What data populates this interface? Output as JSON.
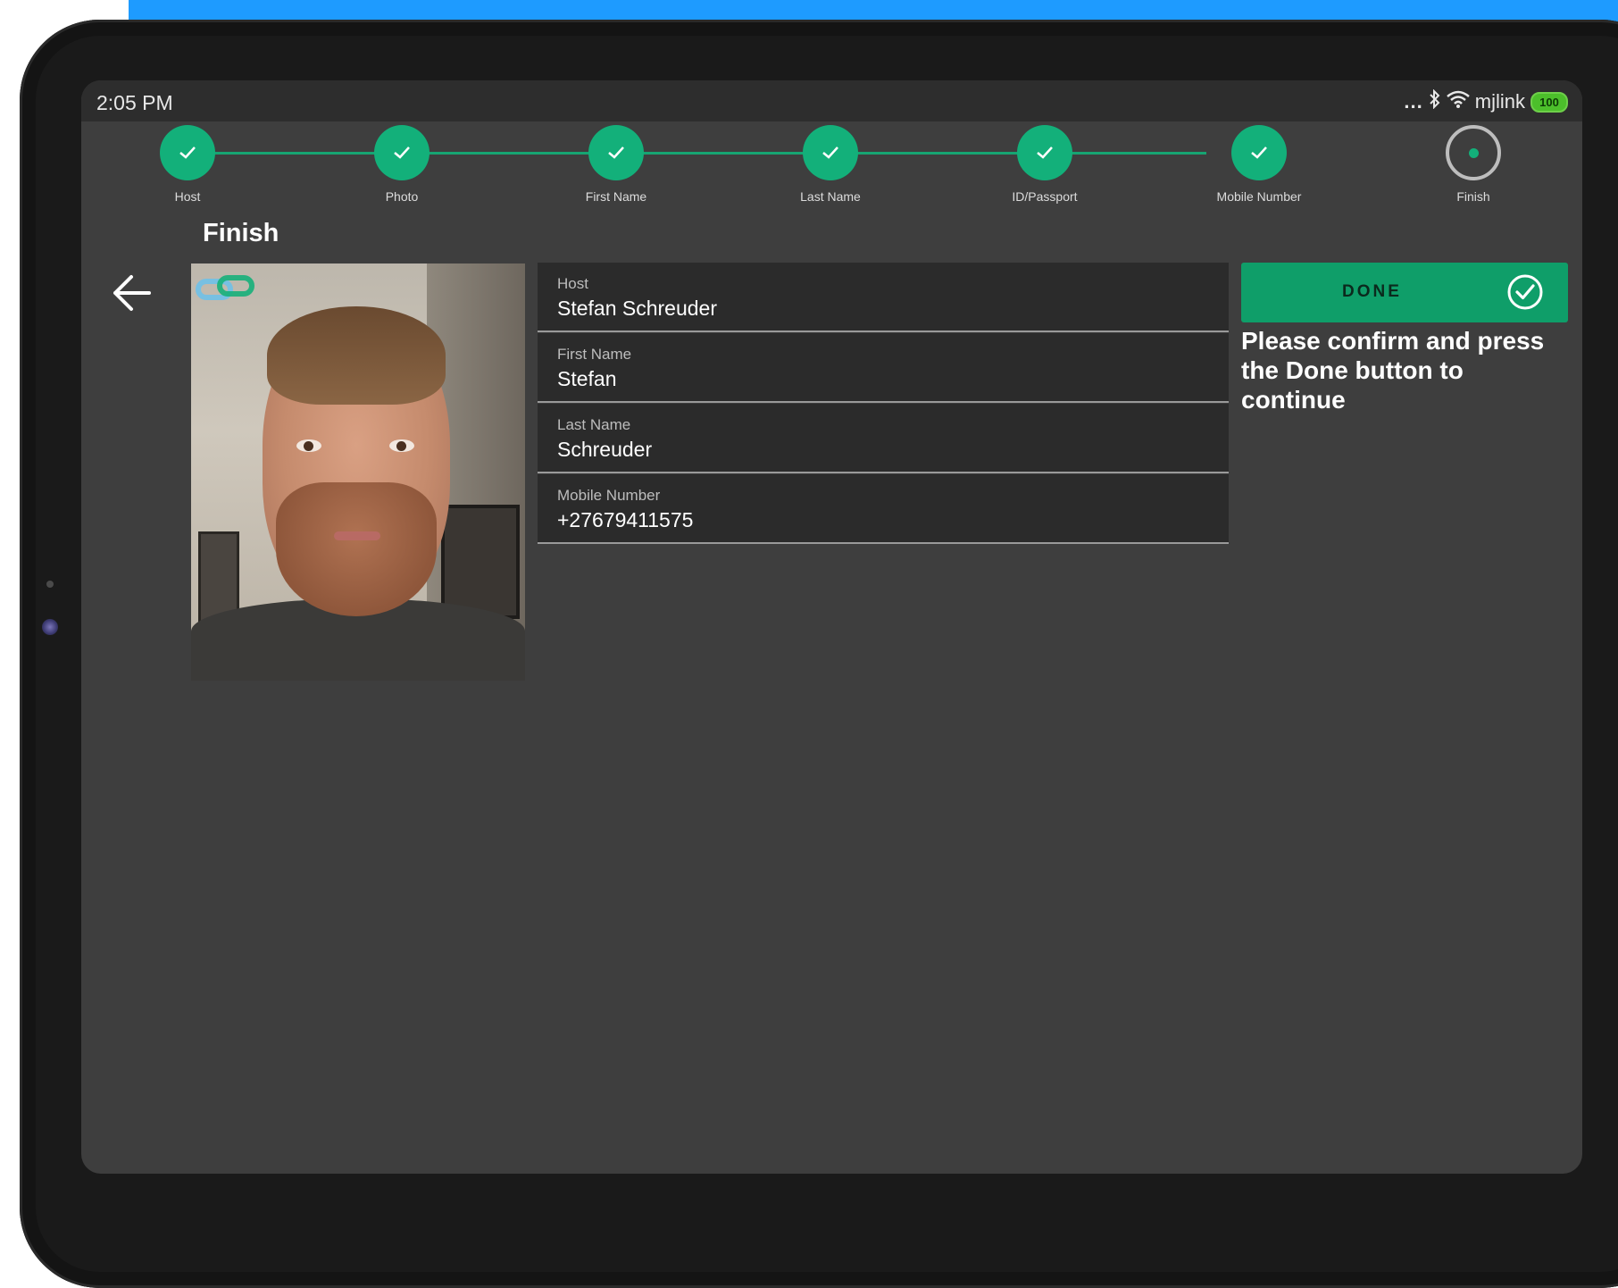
{
  "status_bar": {
    "time": "2:05 PM",
    "network_name": "mjlink",
    "battery_level": "100",
    "more_dots": "...",
    "icons": [
      "bluetooth-icon",
      "wifi-icon",
      "battery-icon"
    ]
  },
  "stepper": {
    "steps": [
      {
        "label": "Host",
        "state": "done"
      },
      {
        "label": "Photo",
        "state": "done"
      },
      {
        "label": "First Name",
        "state": "done"
      },
      {
        "label": "Last Name",
        "state": "done"
      },
      {
        "label": "ID/Passport",
        "state": "done"
      },
      {
        "label": "Mobile Number",
        "state": "done"
      },
      {
        "label": "Finish",
        "state": "current"
      }
    ]
  },
  "page": {
    "title": "Finish"
  },
  "details": {
    "fields": [
      {
        "label": "Host",
        "value": "Stefan Schreuder"
      },
      {
        "label": "First Name",
        "value": "Stefan"
      },
      {
        "label": "Last Name",
        "value": "Schreuder"
      },
      {
        "label": "Mobile Number",
        "value": "+27679411575"
      }
    ]
  },
  "actions": {
    "done_label": "DONE",
    "confirm_text": "Please confirm and press the Done button to continue"
  },
  "colors": {
    "accent": "#13b07a",
    "done_button": "#0f9e69",
    "screen_bg": "#3e3e3e",
    "field_bg": "#2b2b2b",
    "banner": "#1e9bff"
  }
}
